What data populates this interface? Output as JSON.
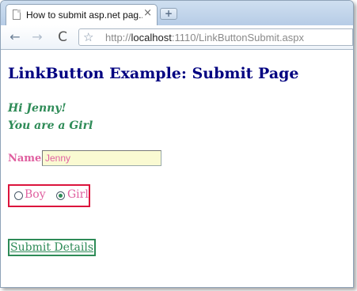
{
  "browser": {
    "tab_title": "How to submit asp.net pag...",
    "tab_close": "×",
    "new_tab": "+",
    "url_prefix": "http://",
    "url_host": "localhost",
    "url_rest": ":1110/LinkButtonSubmit.aspx",
    "back_icon": "←",
    "forward_icon": "→",
    "reload_icon": "C",
    "star_icon": "☆"
  },
  "page": {
    "heading": "LinkButton Example: Submit Page",
    "greeting_line1": "Hi Jenny!",
    "greeting_line2": "You are a Girl",
    "name_label": "Name",
    "name_value": "Jenny",
    "gender_options": [
      {
        "label": "Boy",
        "checked": false
      },
      {
        "label": "Girl",
        "checked": true
      }
    ],
    "submit_label": "Submit Details"
  },
  "colors": {
    "heading": "#000080",
    "greeting": "#2e8b57",
    "label": "#e060a0",
    "gender_border": "#dc143c",
    "submit_border": "#2e8b57",
    "input_bg": "#fafad2"
  }
}
